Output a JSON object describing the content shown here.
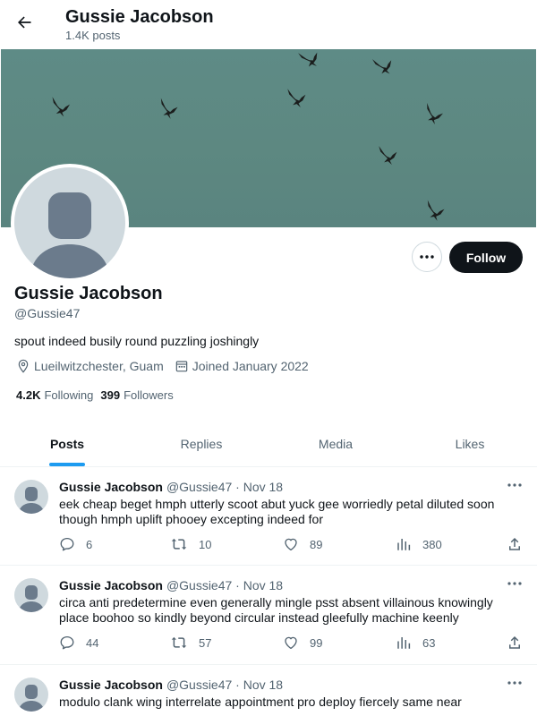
{
  "header": {
    "title": "Gussie Jacobson",
    "post_count": "1.4K posts"
  },
  "profile": {
    "name": "Gussie Jacobson",
    "handle": "@Gussie47",
    "bio": "spout indeed busily round puzzling joshingly",
    "location": "Lueilwitzchester, Guam",
    "joined": "Joined January 2022",
    "following_count": "4.2K",
    "following_label": "Following",
    "followers_count": "399",
    "followers_label": "Followers",
    "follow_button": "Follow"
  },
  "tabs": [
    {
      "label": "Posts",
      "active": true
    },
    {
      "label": "Replies",
      "active": false
    },
    {
      "label": "Media",
      "active": false
    },
    {
      "label": "Likes",
      "active": false
    }
  ],
  "tweets": [
    {
      "name": "Gussie Jacobson",
      "handle_time": "@Gussie47 · Nov 18",
      "text": "eek cheap beget hmph utterly scoot abut yuck gee worriedly petal diluted soon though hmph uplift phooey excepting indeed for",
      "replies": "6",
      "reposts": "10",
      "likes": "89",
      "views": "380"
    },
    {
      "name": "Gussie Jacobson",
      "handle_time": "@Gussie47 · Nov 18",
      "text": "circa anti predetermine even generally mingle psst absent villainous knowingly place boohoo so kindly beyond circular instead gleefully machine keenly",
      "replies": "44",
      "reposts": "57",
      "likes": "99",
      "views": "63"
    },
    {
      "name": "Gussie Jacobson",
      "handle_time": "@Gussie47 · Nov 18",
      "text": "modulo clank wing interrelate appointment pro deploy fiercely same near",
      "replies": "",
      "reposts": "",
      "likes": "",
      "views": ""
    }
  ],
  "icons": {
    "back": "arrow-left-icon",
    "more": "more-icon",
    "location": "location-icon",
    "calendar": "calendar-icon",
    "reply": "reply-icon",
    "repost": "repost-icon",
    "like": "heart-icon",
    "views": "views-icon",
    "share": "share-icon"
  },
  "colors": {
    "accent": "#1d9bf0",
    "banner": "#5d8881",
    "text": "#0f1419",
    "muted": "#536471"
  }
}
